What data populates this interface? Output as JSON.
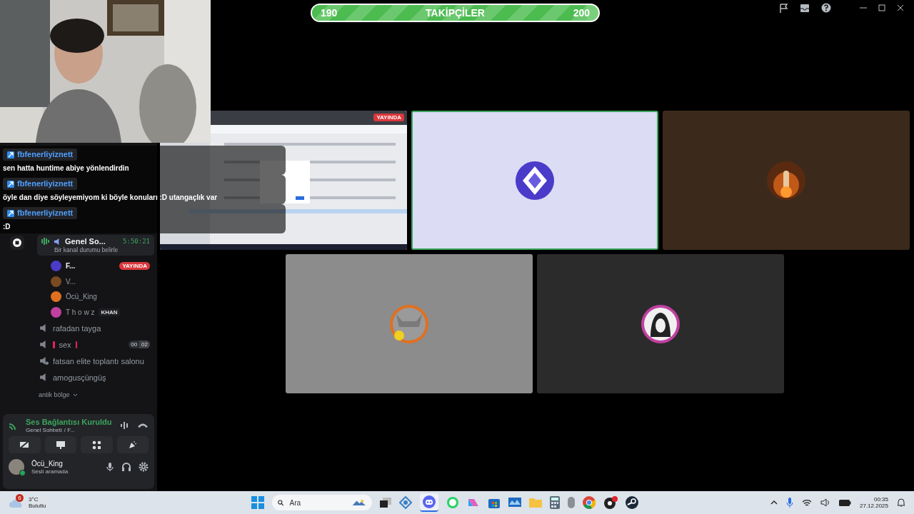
{
  "follower_goal": {
    "start": "190",
    "label": "TAKİPÇİLER",
    "end": "200",
    "level": 0.96
  },
  "chat_overlay": [
    {
      "user": "fbfenerliyiznett",
      "text": "sen hatta huntime abiye yönlendirdin"
    },
    {
      "user": "fbfenerliyiznett",
      "text": "öyle dan diye söyleyemiyom ki böyle konuları :D utangaçlık var"
    },
    {
      "user": "fbfenerliyiznett",
      "text": ":D"
    }
  ],
  "sidebar": {
    "voice_channel": {
      "name": "Genel So...",
      "time": "5:50:21",
      "status": "Bir kanal durumu belirle",
      "members": [
        {
          "name": "F...",
          "badge": "YAYINDA"
        },
        {
          "name": "V..."
        },
        {
          "name": "Öcü_King"
        },
        {
          "name": "T h o w z",
          "tag": "KHAN"
        }
      ]
    },
    "channels": [
      {
        "name": "rafadan tayga",
        "kind": "voice"
      },
      {
        "name": "sex",
        "kind": "alert",
        "counter": [
          "00",
          "02"
        ]
      },
      {
        "name": "fatsan elite toplantı salonu",
        "kind": "locked"
      },
      {
        "name": "amogusçüngüş",
        "kind": "voice"
      }
    ],
    "category": "antik bölge"
  },
  "voice_panel": {
    "status": "Ses Bağlantısı Kuruldu",
    "location": "Genel Sohbeti",
    "location_more": "/ F..."
  },
  "user_panel": {
    "name": "Öcü_King",
    "status": "Sesli aramada"
  },
  "tiles": [
    {
      "kind": "screen",
      "badge": "YAYINDA",
      "selected": false
    },
    {
      "kind": "avatar",
      "selected": true,
      "color": "#dcdcf5"
    },
    {
      "kind": "avatar",
      "selected": false,
      "color": "#3b2a1c"
    },
    {
      "kind": "avatar",
      "selected": false,
      "color": "#8c8c8c"
    },
    {
      "kind": "avatar",
      "selected": false,
      "color": "#2b2b2b"
    }
  ],
  "taskbar": {
    "weather_badge": "6",
    "temperature": "3°C",
    "weather": "Bulutlu",
    "search_placeholder": "Ara",
    "time": "00:35",
    "date": "27.12.2025"
  }
}
